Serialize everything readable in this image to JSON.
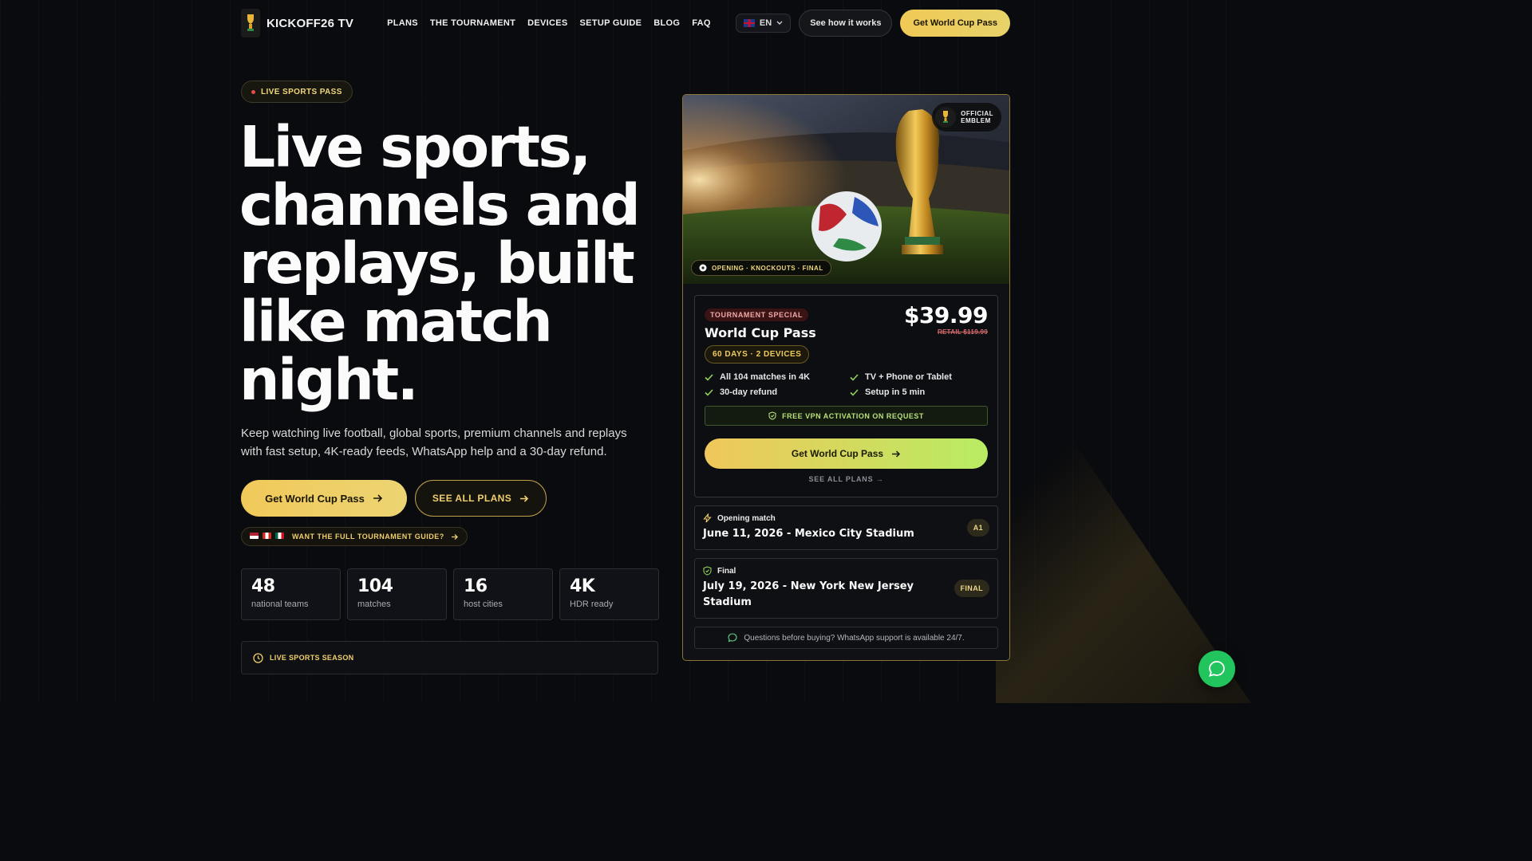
{
  "brand": {
    "name": "KICKOFF26 TV"
  },
  "nav": {
    "links": [
      "PLANS",
      "THE TOURNAMENT",
      "DEVICES",
      "SETUP GUIDE",
      "BLOG",
      "FAQ"
    ],
    "language": "EN",
    "how_it_works": "See how it works",
    "cta": "Get World Cup Pass"
  },
  "hero": {
    "pill": "LIVE SPORTS PASS",
    "title": "Live sports, channels and replays, built like match night.",
    "subtitle": "Keep watching live football, global sports, premium channels and replays with fast setup, 4K-ready feeds, WhatsApp help and a 30-day refund.",
    "cta_primary": "Get World Cup Pass",
    "cta_secondary": "SEE ALL PLANS",
    "guide_link": "WANT THE FULL TOURNAMENT GUIDE?",
    "stats": [
      {
        "value": "48",
        "label": "national teams"
      },
      {
        "value": "104",
        "label": "matches"
      },
      {
        "value": "16",
        "label": "host cities"
      },
      {
        "value": "4K",
        "label": "HDR ready"
      }
    ],
    "season_label": "LIVE SPORTS SEASON"
  },
  "card": {
    "emblem_line1": "OFFICIAL",
    "emblem_line2": "EMBLEM",
    "stage_tag": "OPENING · KNOCKOUTS · FINAL",
    "offer": {
      "badge": "TOURNAMENT SPECIAL",
      "title": "World Cup Pass",
      "duration": "60 DAYS · 2 DEVICES",
      "price": "$39.99",
      "retail": "RETAIL $119.99",
      "features": [
        "All 104 matches in 4K",
        "TV + Phone or Tablet",
        "30-day refund",
        "Setup in 5 min"
      ],
      "vpn_note": "FREE VPN ACTIVATION ON REQUEST",
      "cta": "Get World Cup Pass",
      "see_all": "SEE ALL PLANS →"
    },
    "matches": [
      {
        "label": "Opening match",
        "title": "June 11, 2026 - Mexico City Stadium",
        "badge": "A1"
      },
      {
        "label": "Final",
        "title": "July 19, 2026 - New York New Jersey Stadium",
        "badge": "FINAL"
      }
    ],
    "support_note": "Questions before buying? WhatsApp support is available 24/7."
  },
  "colors": {
    "accent_gold": "#f0c956",
    "accent_green": "#b8ec62",
    "whatsapp": "#22c45e"
  }
}
